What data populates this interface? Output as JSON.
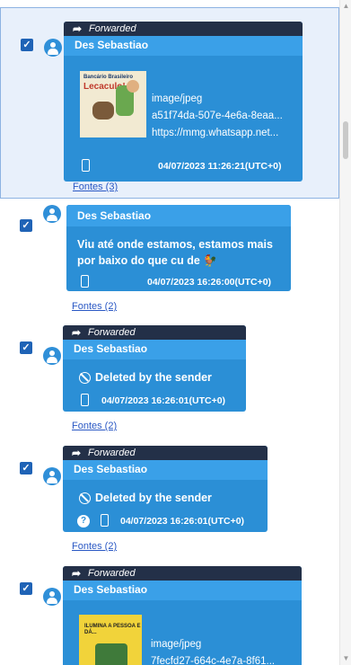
{
  "messages": [
    {
      "forwarded_label": "Forwarded",
      "sender": "Des Sebastiao",
      "thumbnail_text": {
        "line1": "Bancário Brasileiro",
        "line2": "Lecaculo!"
      },
      "attachment": {
        "type": "image/jpeg",
        "id": "a51f74da-507e-4e6a-8eaa...",
        "url": "https://mmg.whatsapp.net..."
      },
      "timestamp": "04/07/2023 11:26:21(UTC+0)",
      "sources_link": "Fontes (3)",
      "selected": true
    },
    {
      "sender": "Des Sebastiao",
      "text_line1": "Viu até onde estamos, estamos mais",
      "text_line2": "por baixo do que cu de",
      "emoji": "🐓",
      "timestamp": "04/07/2023 16:26:00(UTC+0)",
      "sources_link": "Fontes (2)"
    },
    {
      "forwarded_label": "Forwarded",
      "sender": "Des Sebastiao",
      "text": "Deleted by the sender",
      "timestamp": "04/07/2023 16:26:01(UTC+0)",
      "sources_link": "Fontes (2)"
    },
    {
      "forwarded_label": "Forwarded",
      "sender": "Des Sebastiao",
      "text": "Deleted by the sender",
      "help_glyph": "?",
      "timestamp": "04/07/2023 16:26:01(UTC+0)",
      "sources_link": "Fontes (2)"
    },
    {
      "forwarded_label": "Forwarded",
      "sender": "Des Sebastiao",
      "thumbnail_text": "ILUMINA A PESSOA E DÁ...",
      "attachment": {
        "type": "image/jpeg",
        "id": "7fecfd27-664c-4e7a-8f61..."
      }
    }
  ],
  "icons": {
    "check": "✓",
    "forward_arrow": "➦",
    "scroll_up": "▲",
    "scroll_down": "▼"
  },
  "colors": {
    "bubble": "#2b8fd6",
    "sender_bar": "#3aa0e8",
    "forwarded_bar": "#233048",
    "selection": "#e8f0fb",
    "checkbox": "#1f63b6",
    "link": "#2a58c4"
  }
}
